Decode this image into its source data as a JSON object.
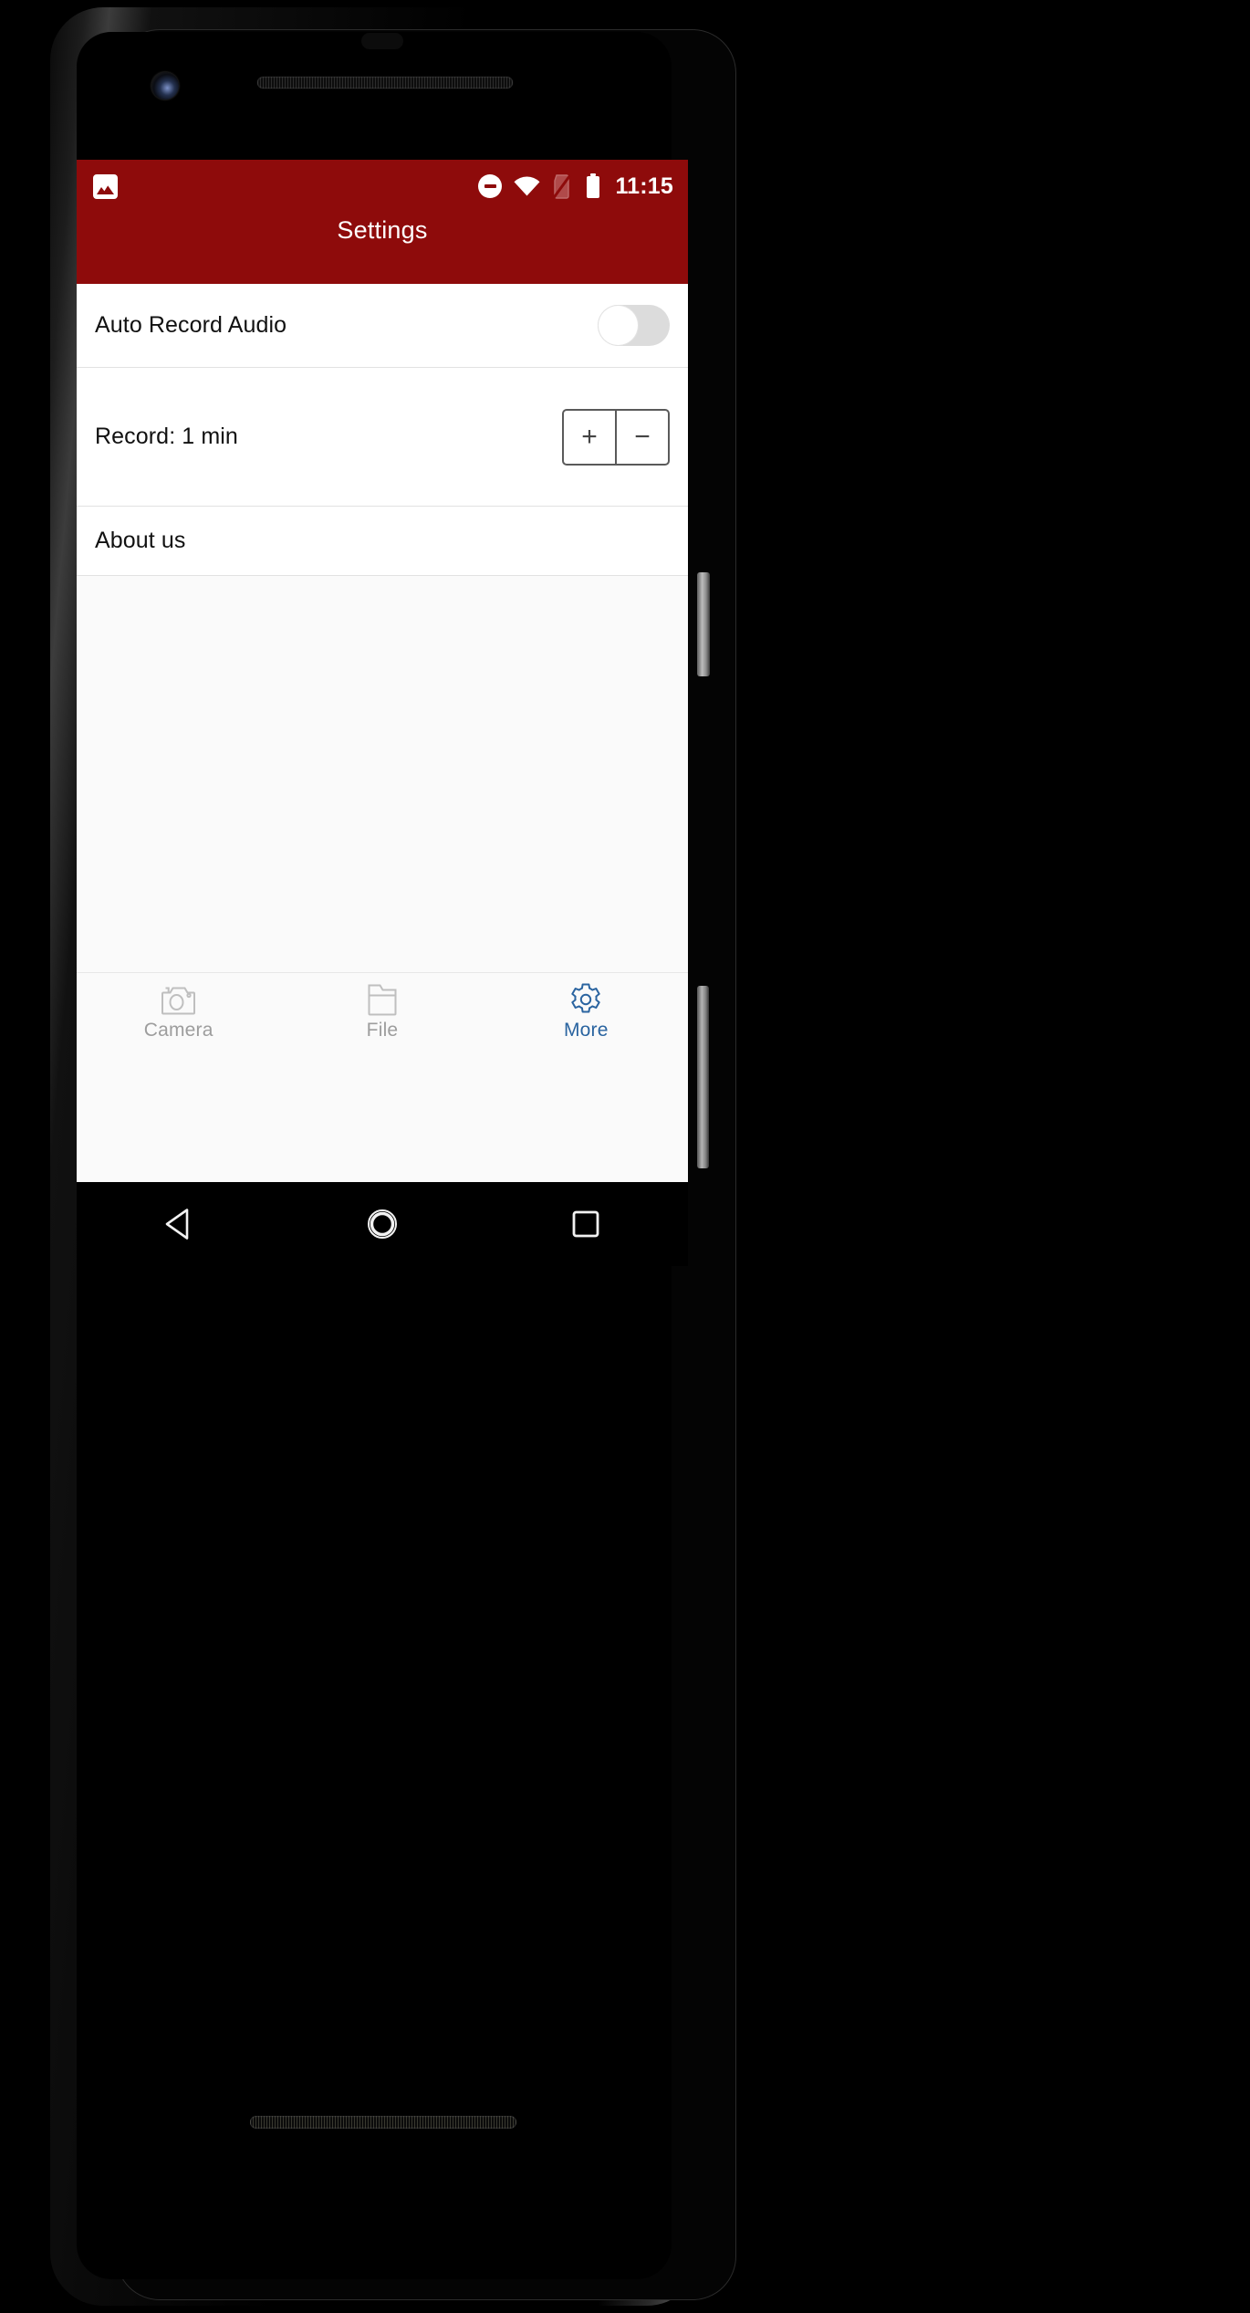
{
  "device": {
    "hardware": {
      "earpiece": "earpiece-speaker",
      "front_camera": "front-camera-lens",
      "proximity_sensor": "proximity-sensor",
      "bottom_speaker": "bottom-speaker-grille",
      "power_button": "power-button",
      "volume_button": "volume-rocker"
    }
  },
  "colors": {
    "app_bar": "#8e0b0b",
    "accent_active_tab": "#2a64a0",
    "inactive_tab": "#9d9d9d",
    "screen_background": "#fafafa",
    "row_background": "#ffffff",
    "divider": "#e2e2e2",
    "toggle_track_off": "#dcdcdc",
    "toggle_thumb": "#ffffff",
    "stepper_border": "#5a5a5a"
  },
  "status_bar": {
    "left_icons": [
      {
        "name": "image-notification-icon",
        "glyph": "image"
      }
    ],
    "right_icons": [
      {
        "name": "do-not-disturb-icon",
        "glyph": "minus-circle"
      },
      {
        "name": "wifi-icon",
        "glyph": "wifi-full"
      },
      {
        "name": "no-sim-signal-icon",
        "glyph": "signal-off"
      },
      {
        "name": "battery-icon",
        "glyph": "battery-full"
      }
    ],
    "clock": "11:15"
  },
  "app_bar": {
    "title": "Settings"
  },
  "settings": {
    "rows": [
      {
        "id": "auto-record-audio",
        "label": "Auto Record Audio",
        "control": "toggle",
        "value": "off"
      },
      {
        "id": "record-duration",
        "label": "Record: 1 min",
        "control": "stepper",
        "value": "1 min",
        "increment_label": "+",
        "decrement_label": "−"
      },
      {
        "id": "about-us",
        "label": "About us",
        "control": "none",
        "value": ""
      }
    ]
  },
  "bottom_nav": {
    "tabs": [
      {
        "id": "camera",
        "label": "Camera",
        "icon": "camera-icon",
        "active": false
      },
      {
        "id": "file",
        "label": "File",
        "icon": "folder-icon",
        "active": false
      },
      {
        "id": "more",
        "label": "More",
        "icon": "gear-icon",
        "active": true
      }
    ]
  },
  "android_nav": {
    "buttons": [
      {
        "id": "back",
        "name": "back-triangle-icon"
      },
      {
        "id": "home",
        "name": "home-circle-icon"
      },
      {
        "id": "recents",
        "name": "recents-square-icon"
      }
    ]
  }
}
